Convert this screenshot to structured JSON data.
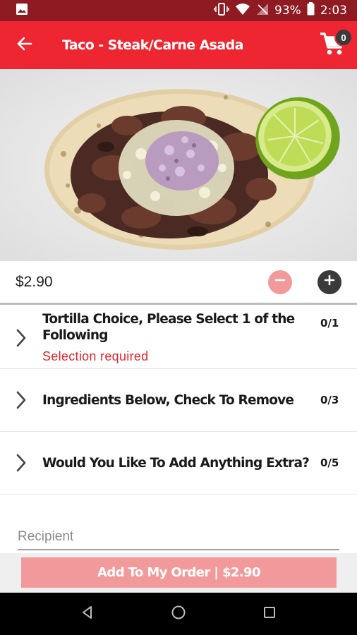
{
  "status_bar": {
    "battery": "93%",
    "time": "2:03"
  },
  "app_bar": {
    "title": "Taco - Steak/Carne Asada",
    "cart_count": "0"
  },
  "hero": {
    "alt": "Steak taco with onion, cilantro and lime wedge"
  },
  "item": {
    "price": "$2.90"
  },
  "options": [
    {
      "title": "Tortilla Choice, Please Select 1 of the Following",
      "count": "0/1",
      "required_text": "Selection required"
    },
    {
      "title": "Ingredients Below, Check To Remove",
      "count": "0/3"
    },
    {
      "title": "Would You Like To Add Anything Extra?",
      "count": "0/5"
    }
  ],
  "recipient": {
    "placeholder": "Recipient"
  },
  "footer": {
    "add_label": "Add To My Order | $2.90"
  },
  "colors": {
    "brand": "#ed2631",
    "status_bar": "#8e1a22",
    "disabled_button": "#f29a9b",
    "required_text": "#e2242e"
  }
}
